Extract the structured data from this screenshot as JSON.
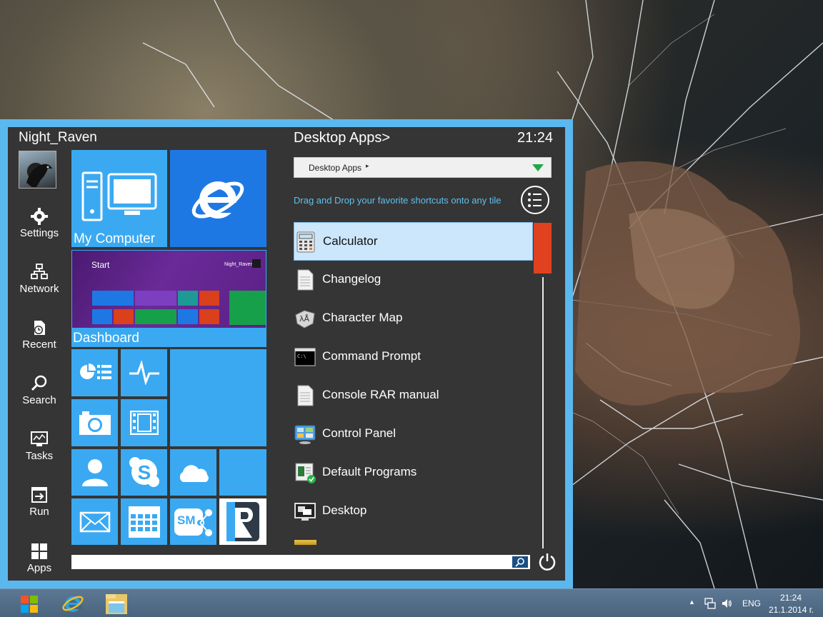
{
  "user": {
    "name": "Night_Raven"
  },
  "nav": [
    {
      "label": "Settings",
      "icon": "gear-icon"
    },
    {
      "label": "Network",
      "icon": "network-icon"
    },
    {
      "label": "Recent",
      "icon": "recent-icon"
    },
    {
      "label": "Search",
      "icon": "search-icon"
    },
    {
      "label": "Tasks",
      "icon": "tasks-icon"
    },
    {
      "label": "Run",
      "icon": "run-icon"
    },
    {
      "label": "Apps",
      "icon": "apps-grid-icon"
    }
  ],
  "tiles": {
    "my_computer": "My Computer",
    "dashboard": "Dashboard",
    "dashboard_preview": {
      "start": "Start",
      "user": "Night_Raven"
    }
  },
  "right": {
    "title": "Desktop Apps>",
    "clock": "21:24",
    "dropdown_value": "Desktop Apps",
    "hint": "Drag and Drop your favorite shortcuts onto any tile"
  },
  "apps": [
    {
      "name": "Calculator",
      "icon": "calculator-icon",
      "selected": true
    },
    {
      "name": "Changelog",
      "icon": "document-icon"
    },
    {
      "name": "Character Map",
      "icon": "character-map-icon"
    },
    {
      "name": "Command Prompt",
      "icon": "command-prompt-icon"
    },
    {
      "name": "Console RAR manual",
      "icon": "document-icon"
    },
    {
      "name": "Control Panel",
      "icon": "control-panel-icon"
    },
    {
      "name": "Default Programs",
      "icon": "default-programs-icon"
    },
    {
      "name": "Desktop",
      "icon": "desktop-icon"
    }
  ],
  "search": {
    "placeholder": ""
  },
  "taskbar": {
    "language": "ENG",
    "time": "21:24",
    "date": "21.1.2014 г."
  },
  "colors": {
    "accent": "#3aa9f2",
    "frame": "#5ab8ef",
    "scroll_thumb": "#e0411f",
    "panel": "#353535"
  }
}
